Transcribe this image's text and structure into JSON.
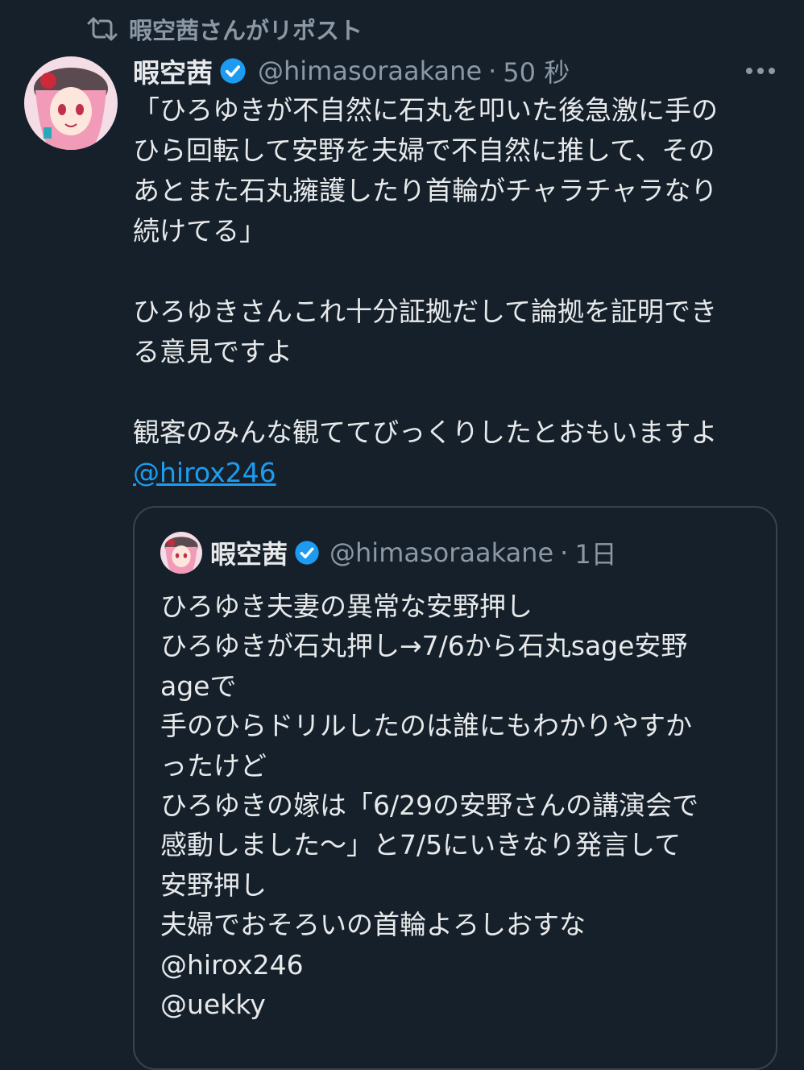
{
  "repost": {
    "label": "暇空茜さんがリポスト",
    "icon": "repost-icon"
  },
  "tweet": {
    "author_name": "暇空茜",
    "handle": "@himasoraakane",
    "separator": "·",
    "time": "50 秒",
    "lines": [
      "「ひろゆきが不自然に石丸を叩いた後急激に手の",
      "ひら回転して安野を夫婦で不自然に推して、その",
      "あとまた石丸擁護したり首輪がチャラチャラなり",
      "続けてる」",
      "",
      "ひろゆきさんこれ十分証拠だして論拠を証明でき",
      "る意見ですよ",
      "",
      "観客のみんな観ててびっくりしたとおもいますよ"
    ],
    "mention": "@hirox246"
  },
  "quote": {
    "author_name": "暇空茜",
    "handle": "@himasoraakane",
    "separator": "·",
    "time": "1日",
    "lines": [
      "ひろゆき夫妻の異常な安野押し",
      "ひろゆきが石丸押し→7/6から石丸sage安野",
      "ageで",
      "手のひらドリルしたのは誰にもわかりやすか",
      "ったけど",
      "ひろゆきの嫁は「6/29の安野さんの講演会で",
      "感動しました〜」と7/5にいきなり発言して",
      "安野押し",
      "夫婦でおそろいの首輪よろしおすな",
      "@hirox246",
      "@uekky"
    ]
  },
  "colors": {
    "background": "#15202b",
    "text": "#e7e9ea",
    "secondary": "#8b98a5",
    "accent": "#1d9bf0",
    "border": "#38444d"
  }
}
